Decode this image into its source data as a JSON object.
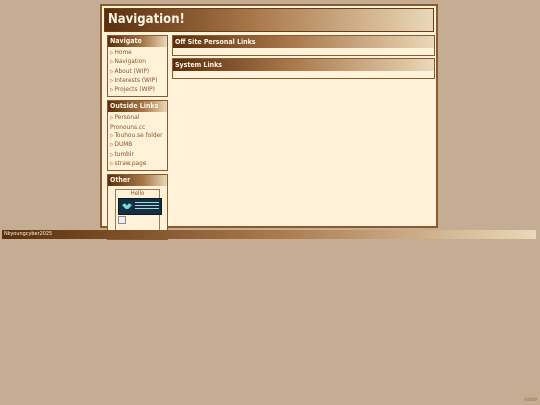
{
  "header": {
    "title": "Navigation!"
  },
  "sidebar": {
    "navigate": {
      "title": "Navigate",
      "items": [
        {
          "label": "Home"
        },
        {
          "label": "Navigation"
        },
        {
          "label": "About (WIP)"
        },
        {
          "label": "Interests (WIP)"
        },
        {
          "label": "Projects (WIP)"
        }
      ]
    },
    "outside": {
      "title": "Outside Links",
      "items": [
        {
          "label": "Personal Pronouns.cc"
        },
        {
          "label": "Touhou.se folder"
        },
        {
          "label": "DUMB"
        },
        {
          "label": "tumblr"
        },
        {
          "label": "straw.page"
        }
      ]
    },
    "other": {
      "title": "Other",
      "greeting": "Hello"
    }
  },
  "main": {
    "sections": [
      {
        "title": "Off Site Personal Links"
      },
      {
        "title": "System Links"
      }
    ]
  },
  "footer": {
    "text": "Nkyoungcyber2025",
    "corner": "st4tk9"
  },
  "colors": {
    "background": "#c4ad92",
    "panel": "#fff2d9",
    "header_dark": "#5a2f0c",
    "header_light": "#ead8b8",
    "link": "#8a5528"
  },
  "icons": {
    "bullet": "triangle-right-icon"
  }
}
